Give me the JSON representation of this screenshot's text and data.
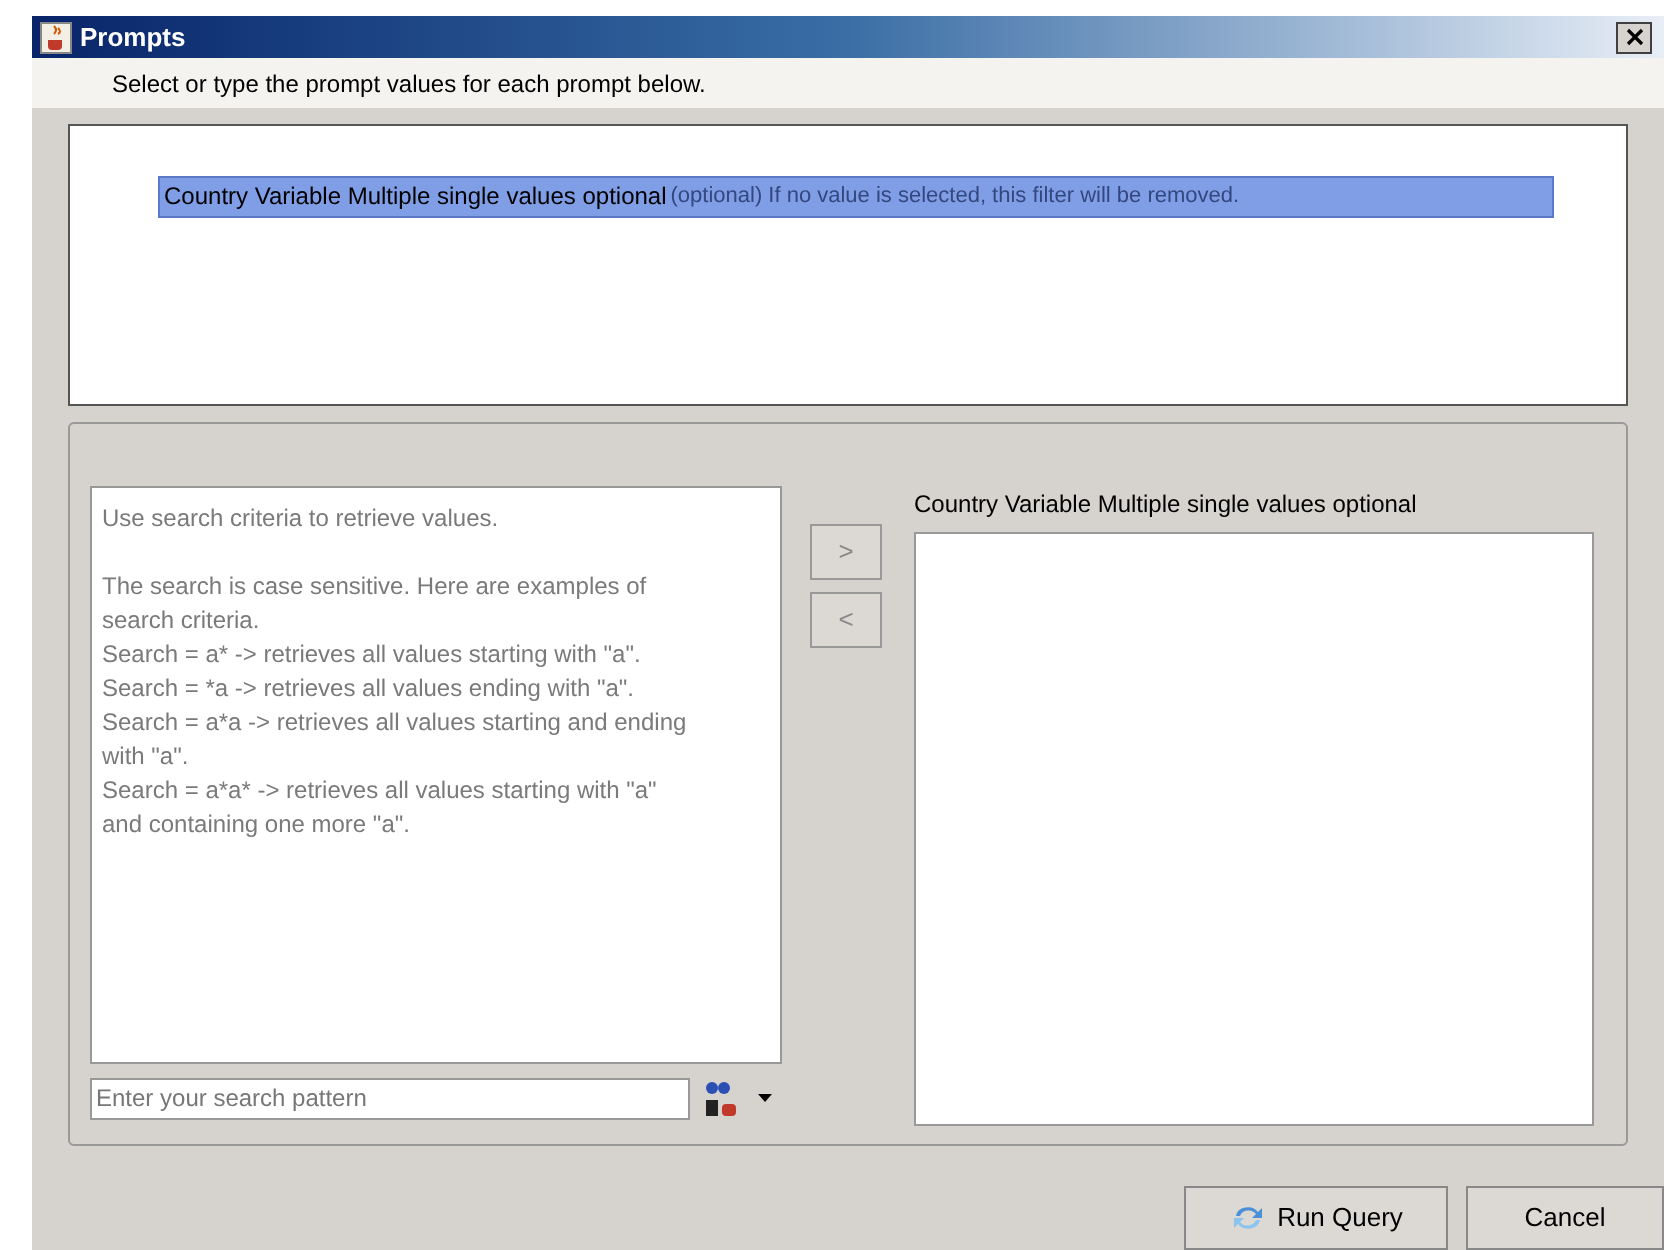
{
  "window": {
    "title": "Prompts"
  },
  "instruction": "Select or type the prompt values for each prompt below.",
  "prompts": [
    {
      "name": "Country Variable Multiple single values optional",
      "note": "(optional) If no value is selected, this filter will be removed.",
      "selected": true
    }
  ],
  "help_text": [
    "Use search criteria to retrieve values.",
    "The search is case sensitive. Here are examples of search criteria.",
    "Search = a* -> retrieves all values starting with \"a\".",
    "Search = *a -> retrieves all values ending with \"a\".",
    "Search = a*a -> retrieves all values starting and ending with \"a\".",
    "Search = a*a* -> retrieves all values starting with \"a\" and containing one more \"a\"."
  ],
  "search": {
    "placeholder": "Enter your search pattern"
  },
  "move_buttons": [
    ">",
    "<"
  ],
  "selected_values": {
    "label": "Country Variable Multiple single values optional"
  },
  "buttons": [
    {
      "label": "Run Query",
      "kind": "run"
    },
    {
      "label": "Cancel",
      "kind": "plain"
    }
  ]
}
